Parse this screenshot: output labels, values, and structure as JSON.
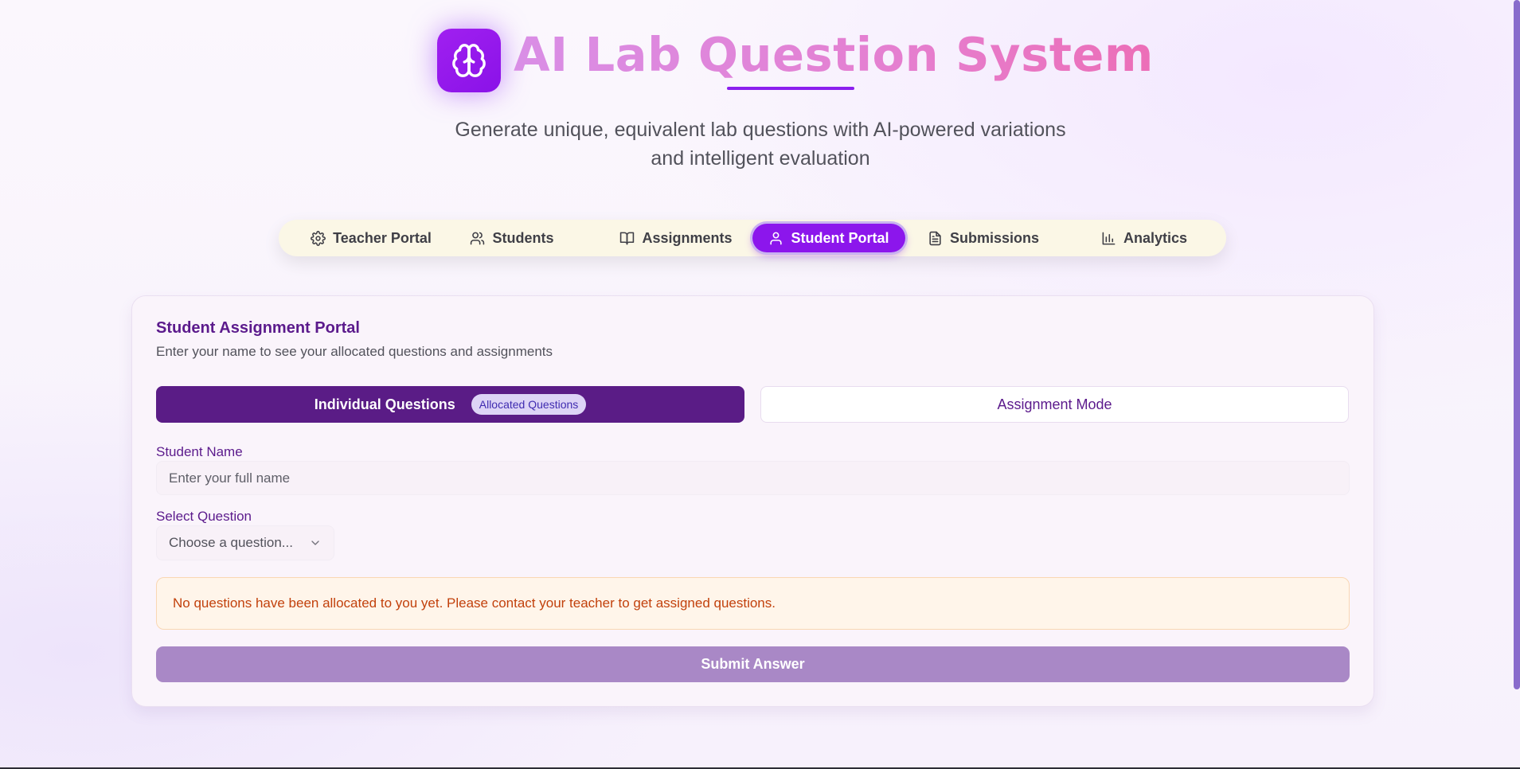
{
  "app": {
    "title": "AI Lab Question System",
    "subtitle_line1": "Generate unique, equivalent lab questions with AI-powered variations",
    "subtitle_line2": "and intelligent evaluation",
    "logo_icon": "brain-icon"
  },
  "nav": {
    "tabs": [
      {
        "label": "Teacher Portal",
        "icon": "gear-icon",
        "active": false
      },
      {
        "label": "Students",
        "icon": "users-icon",
        "active": false
      },
      {
        "label": "Assignments",
        "icon": "book-icon",
        "active": false
      },
      {
        "label": "Student Portal",
        "icon": "user-icon",
        "active": true
      },
      {
        "label": "Submissions",
        "icon": "document-icon",
        "active": false
      },
      {
        "label": "Analytics",
        "icon": "bar-chart-icon",
        "active": false
      }
    ]
  },
  "portal": {
    "title": "Student Assignment Portal",
    "description": "Enter your name to see your allocated questions and assignments",
    "modes": {
      "individual_label": "Individual Questions",
      "individual_badge": "Allocated Questions",
      "assignment_label": "Assignment Mode"
    },
    "student_name": {
      "label": "Student Name",
      "placeholder": "Enter your full name",
      "value": ""
    },
    "select_question": {
      "label": "Select Question",
      "placeholder": "Choose a question..."
    },
    "alert": "No questions have been allocated to you yet. Please contact your teacher to get assigned questions.",
    "submit_label": "Submit Answer"
  },
  "colors": {
    "accent": "#8c16ec",
    "primary_dark": "#5a1c86",
    "title_gradient_start": "#d98ee6",
    "title_gradient_end": "#ec6eb7",
    "nav_background": "#fbf7e6",
    "alert_text": "#c2410c",
    "submit_disabled": "#a988c6"
  }
}
